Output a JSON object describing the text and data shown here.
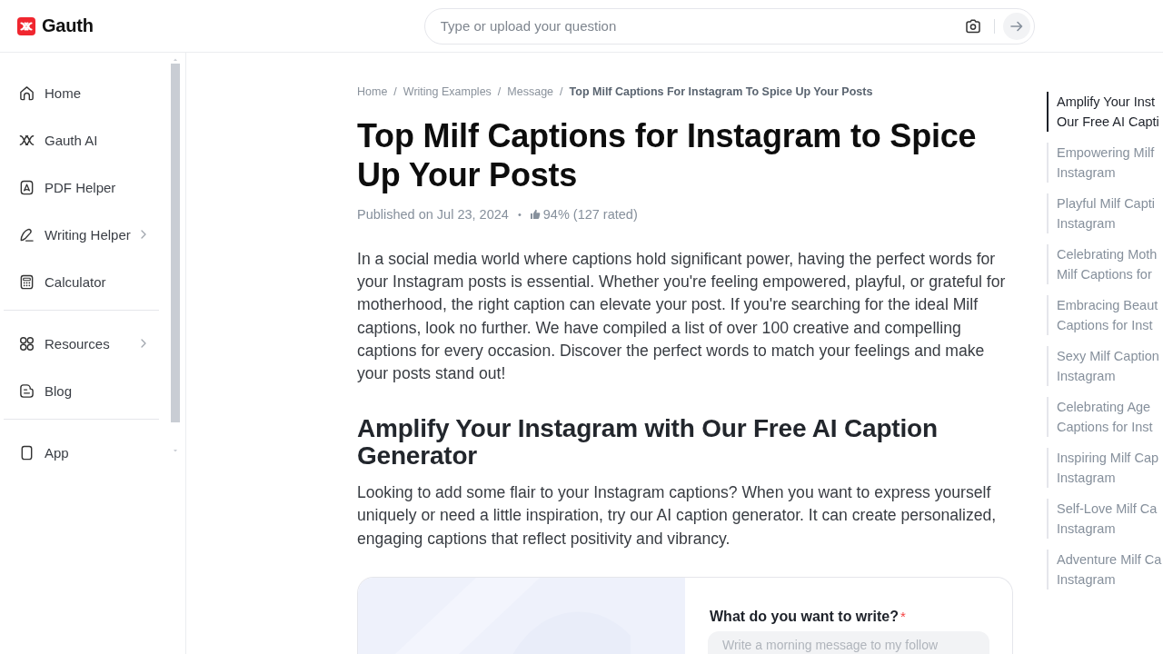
{
  "logo": {
    "text": "Gauth"
  },
  "search": {
    "placeholder": "Type or upload your question"
  },
  "sidebar": {
    "sections": [
      {
        "items": [
          {
            "label": "Home",
            "kind": "link"
          },
          {
            "label": "Gauth AI",
            "kind": "link"
          },
          {
            "label": "PDF Helper",
            "kind": "link"
          },
          {
            "label": "Writing Helper",
            "kind": "menu"
          },
          {
            "label": "Calculator",
            "kind": "link"
          }
        ]
      },
      {
        "items": [
          {
            "label": "Resources",
            "kind": "menu"
          },
          {
            "label": "Blog",
            "kind": "link"
          }
        ]
      },
      {
        "items": [
          {
            "label": "App",
            "kind": "link"
          }
        ]
      }
    ]
  },
  "breadcrumb": {
    "separator": "/",
    "items": [
      {
        "label": "Home",
        "current": false
      },
      {
        "label": "Writing Examples",
        "current": false
      },
      {
        "label": "Message",
        "current": false
      },
      {
        "label": "Top Milf Captions For Instagram To Spice Up Your Posts",
        "current": true
      }
    ]
  },
  "article": {
    "title": "Top Milf Captions for Instagram to Spice Up Your Posts",
    "published": "Published on Jul 23, 2024",
    "separator": "•",
    "rating": "94% (127 rated)",
    "intro": "In a social media world where captions hold significant power, having the perfect words for your Instagram posts is essential. Whether you're feeling empowered, playful, or grateful for motherhood, the right caption can elevate your post. If you're searching for the ideal Milf captions, look no further. We have compiled a list of over 100 creative and compelling captions for every occasion. Discover the perfect words to match your feelings and make your posts stand out!",
    "sections": [
      {
        "heading": "Amplify Your Instagram with Our Free AI Caption Generator",
        "body": "Looking to add some flair to your Instagram captions? When you want to express yourself uniquely or need a little inspiration, try our AI caption generator. It can create personalized, engaging captions that reflect positivity and vibrancy."
      }
    ]
  },
  "generator": {
    "label": "What do you want to write?",
    "required_mark": "*",
    "placeholder": "Write a morning message to my follow"
  },
  "toc": {
    "items": [
      {
        "lines": [
          "Amplify Your Inst",
          "Our Free AI Capti"
        ],
        "selected": true
      },
      {
        "lines": [
          "Empowering Milf",
          "Instagram"
        ],
        "selected": false
      },
      {
        "lines": [
          "Playful Milf Capti",
          "Instagram"
        ],
        "selected": false
      },
      {
        "lines": [
          "Celebrating Moth",
          "Milf Captions for"
        ],
        "selected": false
      },
      {
        "lines": [
          "Embracing Beaut",
          "Captions for Inst"
        ],
        "selected": false
      },
      {
        "lines": [
          "Sexy Milf Caption",
          "Instagram"
        ],
        "selected": false
      },
      {
        "lines": [
          "Celebrating Age",
          "Captions for Inst"
        ],
        "selected": false
      },
      {
        "lines": [
          "Inspiring Milf Cap",
          "Instagram"
        ],
        "selected": false
      },
      {
        "lines": [
          "Self-Love Milf Ca",
          "Instagram"
        ],
        "selected": false
      },
      {
        "lines": [
          "Adventure Milf Ca",
          "Instagram"
        ],
        "selected": false
      }
    ]
  }
}
